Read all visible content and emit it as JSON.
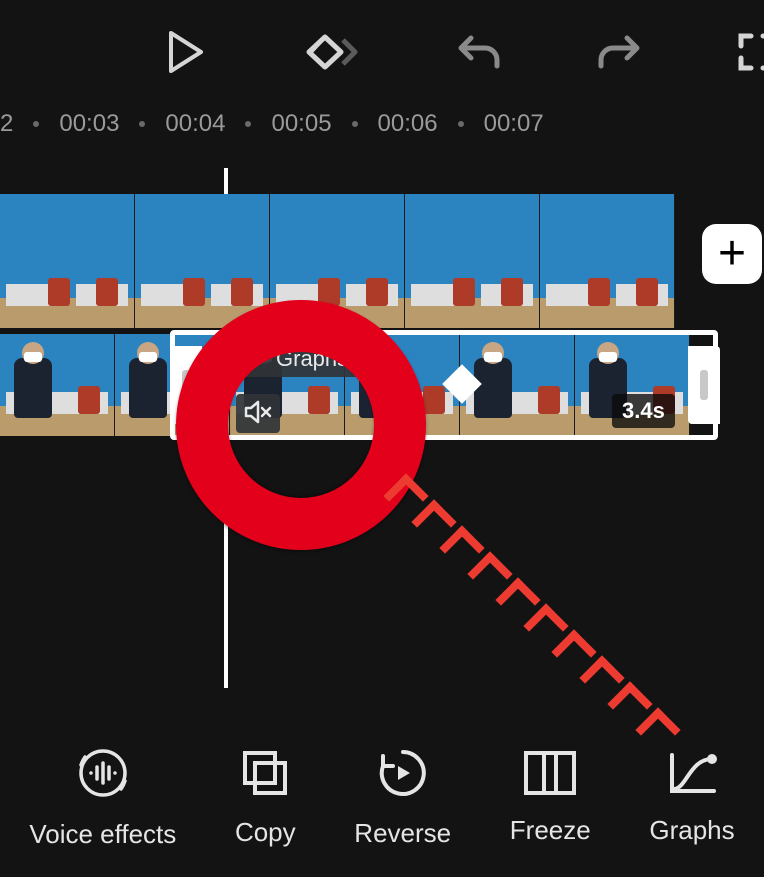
{
  "top_controls": {
    "play_label": "Play",
    "keyframe_label": "Keyframe",
    "undo_label": "Undo",
    "redo_label": "Redo",
    "fullscreen_label": "Fullscreen"
  },
  "ruler": {
    "partial_first": "2",
    "marks": [
      "00:03",
      "00:04",
      "00:05",
      "00:06",
      "00:07"
    ]
  },
  "clip": {
    "chip_label": "Graphs",
    "muted": true,
    "duration": "3.4s"
  },
  "add_button": "+",
  "bottom_tools": [
    {
      "id": "voice-effects",
      "label": "Voice effects"
    },
    {
      "id": "copy",
      "label": "Copy"
    },
    {
      "id": "reverse",
      "label": "Reverse"
    },
    {
      "id": "freeze",
      "label": "Freeze"
    },
    {
      "id": "graphs",
      "label": "Graphs"
    }
  ],
  "annotation": {
    "highlight": "red-circle",
    "arrow_target": "graphs"
  }
}
